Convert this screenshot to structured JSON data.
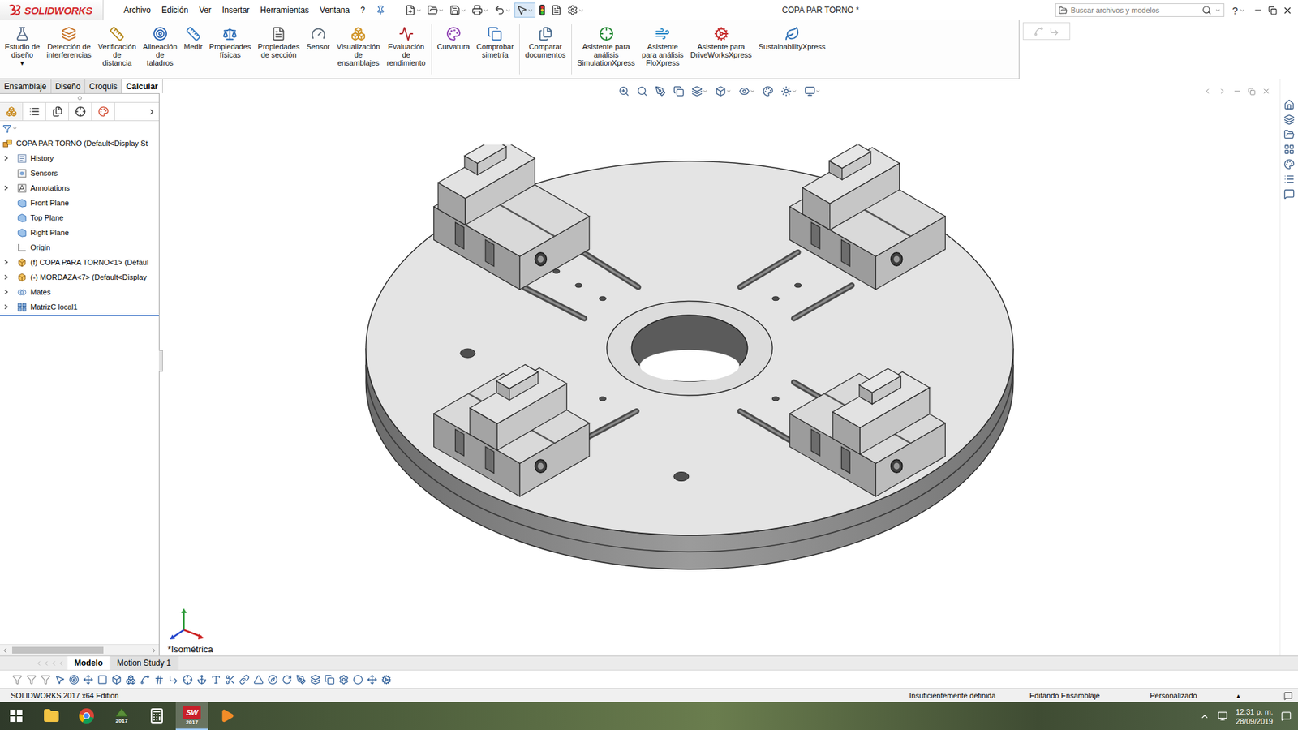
{
  "window": {
    "title": "COPA PAR TORNO *",
    "help": "?"
  },
  "app": {
    "logo": "SOLIDWORKS"
  },
  "menu": [
    "Archivo",
    "Edición",
    "Ver",
    "Insertar",
    "Herramientas",
    "Ventana",
    "?"
  ],
  "search": {
    "placeholder": "Buscar archivos y modelos"
  },
  "ribbon": [
    {
      "lines": [
        "Estudio de",
        "diseño"
      ],
      "caret": "▾",
      "separator_before": false
    },
    {
      "lines": [
        "Detección de",
        "interferencias"
      ],
      "separator_before": false
    },
    {
      "lines": [
        "Verificación",
        "de",
        "distancia"
      ],
      "separator_before": false
    },
    {
      "lines": [
        "Alineación",
        "de",
        "taladros"
      ],
      "separator_before": false
    },
    {
      "lines": [
        "Medir"
      ],
      "separator_before": false
    },
    {
      "lines": [
        "Propiedades",
        "físicas"
      ],
      "separator_before": false
    },
    {
      "lines": [
        "Propiedades",
        "de sección"
      ],
      "separator_before": false
    },
    {
      "lines": [
        "Sensor"
      ],
      "separator_before": false
    },
    {
      "lines": [
        "Visualización",
        "de",
        "ensamblajes"
      ],
      "separator_before": false
    },
    {
      "lines": [
        "Evaluación",
        "de",
        "rendimiento"
      ],
      "separator_before": false
    },
    {
      "lines": [
        "Curvatura"
      ],
      "separator_before": true
    },
    {
      "lines": [
        "Comprobar",
        "simetría"
      ],
      "separator_before": false
    },
    {
      "lines": [
        "Comparar",
        "documentos"
      ],
      "separator_before": true
    },
    {
      "lines": [
        "Asistente para",
        "análisis",
        "SimulationXpress"
      ],
      "separator_before": true
    },
    {
      "lines": [
        "Asistente",
        "para análisis",
        "FloXpress"
      ],
      "separator_before": false
    },
    {
      "lines": [
        "Asistente para",
        "DriveWorksXpress"
      ],
      "separator_before": false
    },
    {
      "lines": [
        "SustainabilityXpress"
      ],
      "separator_before": false
    }
  ],
  "command_tabs": [
    {
      "label": "Ensamblaje",
      "selected": false
    },
    {
      "label": "Diseño",
      "selected": false
    },
    {
      "label": "Croquis",
      "selected": false
    },
    {
      "label": "Calcular",
      "selected": true
    }
  ],
  "tree": {
    "items": [
      {
        "label": "COPA PAR TORNO (Default<Display St",
        "kind": "assembly",
        "depth": 0,
        "expandable": false
      },
      {
        "label": "History",
        "kind": "history",
        "depth": 1,
        "expandable": true
      },
      {
        "label": "Sensors",
        "kind": "sensor",
        "depth": 1,
        "expandable": false
      },
      {
        "label": "Annotations",
        "kind": "annotation",
        "depth": 1,
        "expandable": true
      },
      {
        "label": "Front Plane",
        "kind": "plane",
        "depth": 1,
        "expandable": false
      },
      {
        "label": "Top Plane",
        "kind": "plane",
        "depth": 1,
        "expandable": false
      },
      {
        "label": "Right Plane",
        "kind": "plane",
        "depth": 1,
        "expandable": false
      },
      {
        "label": "Origin",
        "kind": "origin",
        "depth": 1,
        "expandable": false
      },
      {
        "label": "(f) COPA PARA TORNO<1> (Defaul",
        "kind": "part",
        "depth": 1,
        "expandable": true
      },
      {
        "label": "(-) MORDAZA<7> (Default<Display",
        "kind": "part-under",
        "depth": 1,
        "expandable": true
      },
      {
        "label": "Mates",
        "kind": "mates",
        "depth": 1,
        "expandable": true
      },
      {
        "label": "MatrizC local1",
        "kind": "pattern",
        "depth": 1,
        "expandable": true
      }
    ]
  },
  "panel_scrollbar": {
    "level": 0.66
  },
  "viewport": {
    "view_label": "*Isométrica"
  },
  "bottom_tabs": [
    {
      "label": "Modelo",
      "selected": true
    },
    {
      "label": "Motion Study 1",
      "selected": false
    }
  ],
  "status_bar": {
    "edition": "SOLIDWORKS 2017 x64 Edition",
    "definition": "Insuficientemente definida",
    "mode": "Editando Ensamblaje",
    "units": "Personalizado",
    "units_caret": "▴"
  },
  "taskbar": {
    "time": "12:31 p. m.",
    "date": "28/09/2019",
    "apps": [
      {
        "kind": "explorer",
        "active": false
      },
      {
        "kind": "chrome",
        "active": false
      },
      {
        "kind": "draftsight",
        "label": "2017",
        "active": false
      },
      {
        "kind": "calculator",
        "active": false
      },
      {
        "kind": "solidworks",
        "badge": "SW",
        "label": "2017",
        "active": true
      },
      {
        "kind": "media",
        "active": false
      }
    ]
  }
}
